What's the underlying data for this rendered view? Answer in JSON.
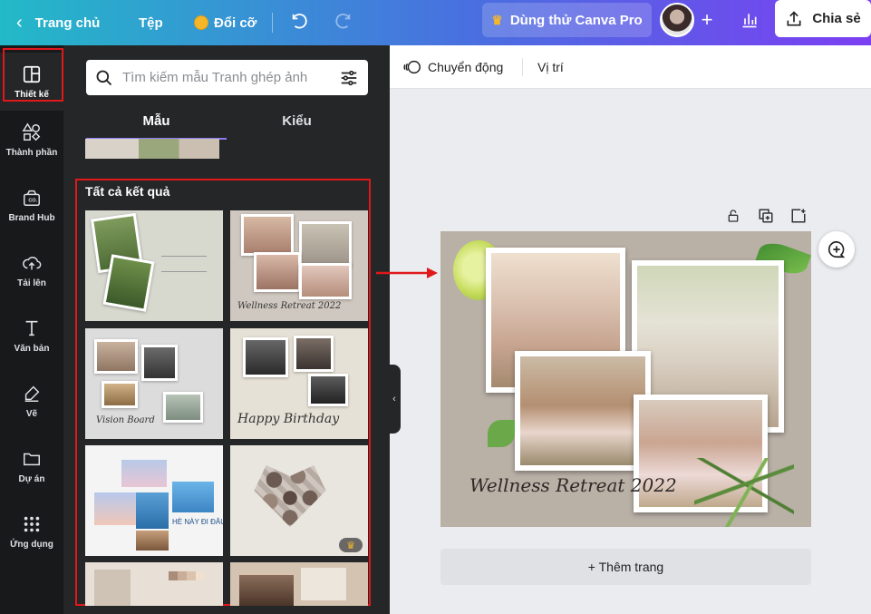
{
  "topbar": {
    "back_label": "Trang chủ",
    "file_label": "Tệp",
    "resize_label": "Đổi cỡ",
    "try_pro_label": "Dùng thử Canva Pro",
    "share_label": "Chia sẻ"
  },
  "rail": {
    "items": [
      {
        "label": "Thiết kế",
        "icon": "layout-icon"
      },
      {
        "label": "Thành phần",
        "icon": "shapes-icon"
      },
      {
        "label": "Brand Hub",
        "icon": "brand-icon"
      },
      {
        "label": "Tải lên",
        "icon": "upload-icon"
      },
      {
        "label": "Văn bản",
        "icon": "text-icon"
      },
      {
        "label": "Vẽ",
        "icon": "draw-icon"
      },
      {
        "label": "Dự án",
        "icon": "folder-icon"
      },
      {
        "label": "Ứng dụng",
        "icon": "apps-icon"
      }
    ]
  },
  "panel": {
    "search_placeholder": "Tìm kiếm mẫu Tranh ghép ảnh",
    "tabs": [
      "Mẫu",
      "Kiểu"
    ],
    "results_title": "Tất cả kết quả",
    "thumb_texts": {
      "t3": "Vision Board",
      "t4": "Happy Birthday",
      "t5": "HÈ NÀY ĐI ĐÂU?",
      "t2": "Wellness Retreat 2022"
    }
  },
  "editor": {
    "animate_label": "Chuyển động",
    "position_label": "Vị trí",
    "canvas_caption": "Wellness Retreat 2022",
    "add_page_label": "+ Thêm trang"
  },
  "colors": {
    "accent": "#8b7cf6",
    "highlight": "#e0181c",
    "canvas_bg": "#b9b0a6"
  }
}
